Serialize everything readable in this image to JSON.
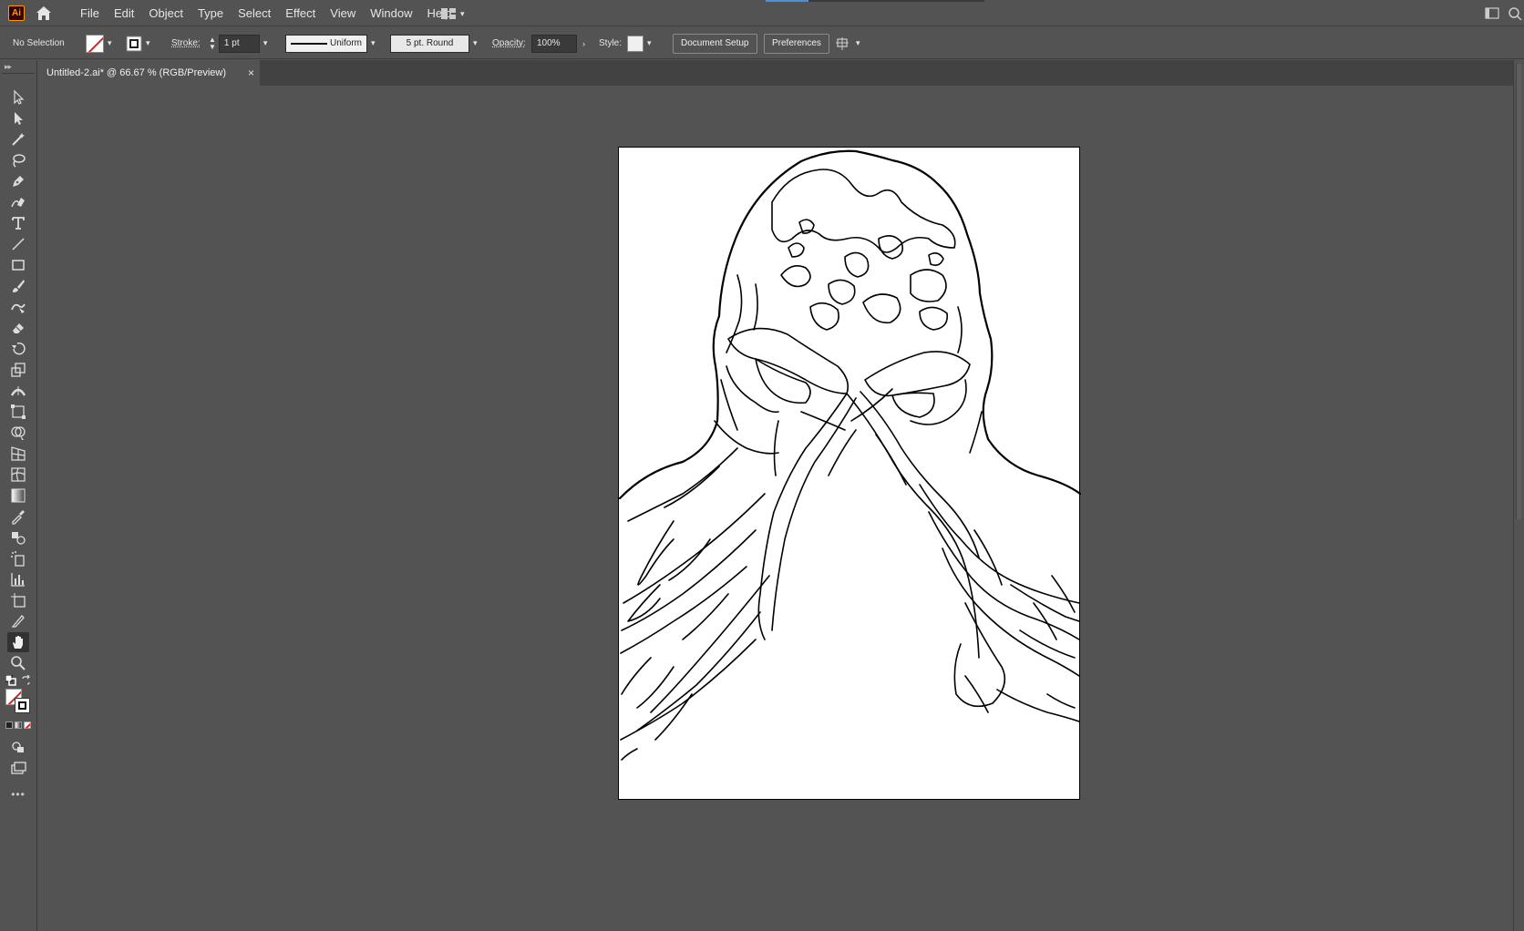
{
  "app": {
    "logo_text": "Ai",
    "brand_color": "#ff9a00"
  },
  "menu": {
    "items": [
      "File",
      "Edit",
      "Object",
      "Type",
      "Select",
      "Effect",
      "View",
      "Window",
      "Help"
    ]
  },
  "control": {
    "selection_status": "No Selection",
    "stroke_label": "Stroke:",
    "stroke_value": "1 pt",
    "profile_value": "Uniform",
    "brush_value": "5 pt. Round",
    "opacity_label": "Opacity:",
    "opacity_value": "100%",
    "style_label": "Style:",
    "document_setup_label": "Document Setup",
    "preferences_label": "Preferences"
  },
  "document": {
    "tab_title": "Untitled-2.ai* @ 66.67 % (RGB/Preview)",
    "close_glyph": "×"
  },
  "tools": [
    "selection-tool",
    "direct-selection-tool",
    "magic-wand-tool",
    "lasso-tool",
    "pen-tool",
    "curvature-tool",
    "type-tool",
    "line-segment-tool",
    "rectangle-tool",
    "paintbrush-tool",
    "shaper-tool",
    "eraser-tool",
    "rotate-tool",
    "scale-tool",
    "width-tool",
    "free-transform-tool",
    "shape-builder-tool",
    "perspective-grid-tool",
    "mesh-tool",
    "gradient-tool",
    "eyedropper-tool",
    "blend-tool",
    "symbol-sprayer-tool",
    "column-graph-tool",
    "artboard-tool",
    "slice-tool",
    "hand-tool",
    "zoom-tool"
  ],
  "toolbar_more": "•••",
  "colors": {
    "ui_background": "#535353",
    "artboard": "#ffffff",
    "stroke_none_red": "#e02020"
  }
}
